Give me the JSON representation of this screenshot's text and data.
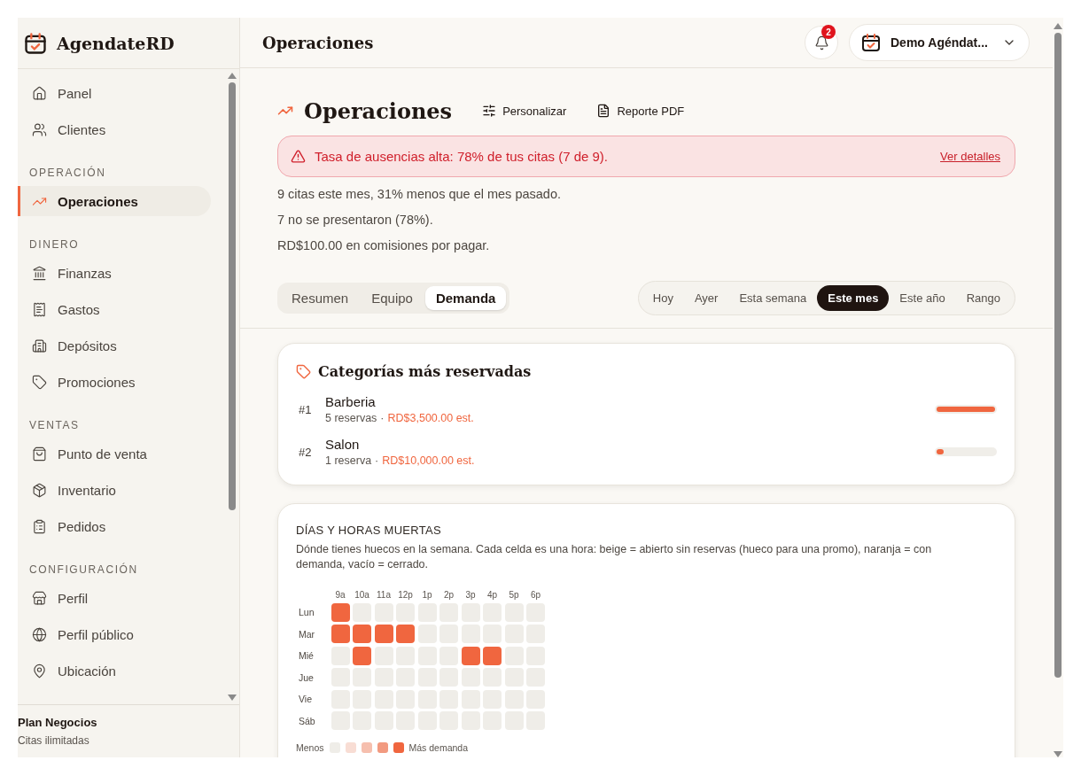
{
  "brand": {
    "name": "AgendateRD"
  },
  "sidebar": {
    "sections": [
      {
        "items": [
          {
            "label": "Panel",
            "selected": false
          },
          {
            "label": "Clientes",
            "selected": false
          }
        ]
      },
      {
        "title": "OPERACIÓN",
        "items": [
          {
            "label": "Operaciones",
            "selected": true
          }
        ]
      },
      {
        "title": "DINERO",
        "items": [
          {
            "label": "Finanzas",
            "selected": false
          },
          {
            "label": "Gastos",
            "selected": false
          },
          {
            "label": "Depósitos",
            "selected": false
          },
          {
            "label": "Promociones",
            "selected": false
          }
        ]
      },
      {
        "title": "VENTAS",
        "items": [
          {
            "label": "Punto de venta",
            "selected": false
          },
          {
            "label": "Inventario",
            "selected": false
          },
          {
            "label": "Pedidos",
            "selected": false
          }
        ]
      },
      {
        "title": "CONFIGURACIÓN",
        "items": [
          {
            "label": "Perfil",
            "selected": false
          },
          {
            "label": "Perfil público",
            "selected": false
          },
          {
            "label": "Ubicación",
            "selected": false
          }
        ]
      }
    ],
    "plan": {
      "name": "Plan Negocios",
      "detail": "Citas ilimitadas"
    }
  },
  "header": {
    "title": "Operaciones",
    "notifications": "2",
    "account": "Demo Agéndat..."
  },
  "page": {
    "title": "Operaciones",
    "actions": [
      "Personalizar",
      "Reporte PDF"
    ],
    "alert": {
      "text": "Tasa de ausencias alta: 78% de tus citas (7 de 9).",
      "link": "Ver detalles"
    },
    "summary": [
      "9 citas este mes, 31% menos que el mes pasado.",
      "7 no se presentaron (78%).",
      "RD$100.00 en comisiones por pagar."
    ],
    "tabs": [
      {
        "label": "Resumen",
        "selected": false
      },
      {
        "label": "Equipo",
        "selected": false
      },
      {
        "label": "Demanda",
        "selected": true
      }
    ],
    "periods": [
      {
        "label": "Hoy",
        "selected": false
      },
      {
        "label": "Ayer",
        "selected": false
      },
      {
        "label": "Esta semana",
        "selected": false
      },
      {
        "label": "Este mes",
        "selected": true
      },
      {
        "label": "Este año",
        "selected": false
      },
      {
        "label": "Rango",
        "selected": false
      }
    ]
  },
  "categories": {
    "title": "Categorías más reservadas",
    "items": [
      {
        "rank": "#1",
        "name": "Barberia",
        "count": "5 reservas",
        "separator": "·",
        "estimate": "RD$3,500.00 est.",
        "level": 1
      },
      {
        "rank": "#2",
        "name": "Salon",
        "count": "1 reserva",
        "separator": "·",
        "estimate": "RD$10,000.00 est.",
        "level": 0.12
      }
    ]
  },
  "heatmap": {
    "title": "DÍAS Y HORAS MUERTAS",
    "description": "Dónde tienes huecos en la semana. Cada celda es una hora: beige = abierto sin reservas (hueco para una promo), naranja = con demanda, vacío = cerrado.",
    "columns": [
      "9a",
      "10a",
      "11a",
      "12p",
      "1p",
      "2p",
      "3p",
      "4p",
      "5p",
      "6p"
    ],
    "rows": [
      {
        "label": "Lun",
        "cells": [
          {
            "busy": true
          },
          {
            "busy": false
          },
          {
            "busy": false
          },
          {
            "busy": false
          },
          {
            "busy": false
          },
          {
            "busy": false
          },
          {
            "busy": false
          },
          {
            "busy": false
          },
          {
            "busy": false
          },
          {
            "busy": false
          }
        ]
      },
      {
        "label": "Mar",
        "cells": [
          {
            "busy": true
          },
          {
            "busy": true
          },
          {
            "busy": true
          },
          {
            "busy": true
          },
          {
            "busy": false
          },
          {
            "busy": false
          },
          {
            "busy": false
          },
          {
            "busy": false
          },
          {
            "busy": false
          },
          {
            "busy": false
          }
        ]
      },
      {
        "label": "Mié",
        "cells": [
          {
            "busy": false
          },
          {
            "busy": true
          },
          {
            "busy": false
          },
          {
            "busy": false
          },
          {
            "busy": false
          },
          {
            "busy": false
          },
          {
            "busy": true
          },
          {
            "busy": true
          },
          {
            "busy": false
          },
          {
            "busy": false
          }
        ]
      },
      {
        "label": "Jue",
        "cells": [
          {
            "busy": false
          },
          {
            "busy": false
          },
          {
            "busy": false
          },
          {
            "busy": false
          },
          {
            "busy": false
          },
          {
            "busy": false
          },
          {
            "busy": false
          },
          {
            "busy": false
          },
          {
            "busy": false
          },
          {
            "busy": false
          }
        ]
      },
      {
        "label": "Vie",
        "cells": [
          {
            "busy": false
          },
          {
            "busy": false
          },
          {
            "busy": false
          },
          {
            "busy": false
          },
          {
            "busy": false
          },
          {
            "busy": false
          },
          {
            "busy": false
          },
          {
            "busy": false
          },
          {
            "busy": false
          },
          {
            "busy": false
          }
        ]
      },
      {
        "label": "Sáb",
        "cells": [
          {
            "busy": false
          },
          {
            "busy": false
          },
          {
            "busy": false
          },
          {
            "busy": false
          },
          {
            "busy": false
          },
          {
            "busy": false
          },
          {
            "busy": false
          },
          {
            "busy": false
          },
          {
            "busy": false
          },
          {
            "busy": false
          }
        ]
      }
    ],
    "legend": {
      "low": "Menos",
      "high": "Más demanda",
      "swatches": [
        {
          "color": "#efede8"
        },
        {
          "color": "#f8ddd4"
        },
        {
          "color": "#f6bfae"
        },
        {
          "color": "#f29a80"
        },
        {
          "color": "#f0663f"
        }
      ]
    }
  }
}
